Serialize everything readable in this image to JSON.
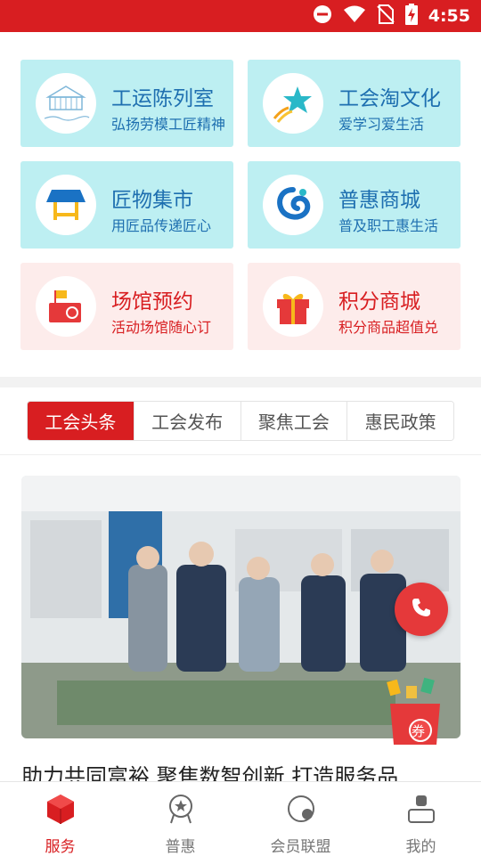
{
  "status_bar": {
    "time": "4:55",
    "icons": [
      "do-not-disturb-icon",
      "wifi-icon",
      "no-sim-icon",
      "battery-charging-icon"
    ],
    "background": "#d81e21"
  },
  "services": [
    {
      "title": "工运陈列室",
      "subtitle": "弘扬劳模工匠精神",
      "icon": "exhibition-hall-icon",
      "theme": "blue"
    },
    {
      "title": "工会淘文化",
      "subtitle": "爱学习爱生活",
      "icon": "shooting-star-icon",
      "theme": "blue"
    },
    {
      "title": "匠物集市",
      "subtitle": "用匠品传递匠心",
      "icon": "market-stall-icon",
      "theme": "blue"
    },
    {
      "title": "普惠商城",
      "subtitle": "普及职工惠生活",
      "icon": "mall-swirl-icon",
      "theme": "blue"
    },
    {
      "title": "场馆预约",
      "subtitle": "活动场馆随心订",
      "icon": "venue-flag-icon",
      "theme": "pink"
    },
    {
      "title": "积分商城",
      "subtitle": "积分商品超值兑",
      "icon": "gift-box-icon",
      "theme": "pink"
    }
  ],
  "news_tabs": [
    {
      "label": "工会头条",
      "active": true
    },
    {
      "label": "工会发布",
      "active": false
    },
    {
      "label": "聚焦工会",
      "active": false
    },
    {
      "label": "惠民政策",
      "active": false
    }
  ],
  "news": {
    "image": "news-photo",
    "headline": "助力共同富裕 聚焦数智创新 打造服务品"
  },
  "floating": {
    "phone": "phone-icon",
    "coupon_label": "券"
  },
  "bottom_nav": [
    {
      "label": "服务",
      "icon": "service-cube-icon",
      "active": true
    },
    {
      "label": "普惠",
      "icon": "medal-star-icon",
      "active": false
    },
    {
      "label": "会员联盟",
      "icon": "member-alliance-icon",
      "active": false
    },
    {
      "label": "我的",
      "icon": "profile-icon",
      "active": false
    }
  ],
  "colors": {
    "brand_red": "#d81e21",
    "card_blue": "#bdeff2",
    "card_pink": "#fdeceb",
    "text_blue": "#1e6fb0"
  }
}
